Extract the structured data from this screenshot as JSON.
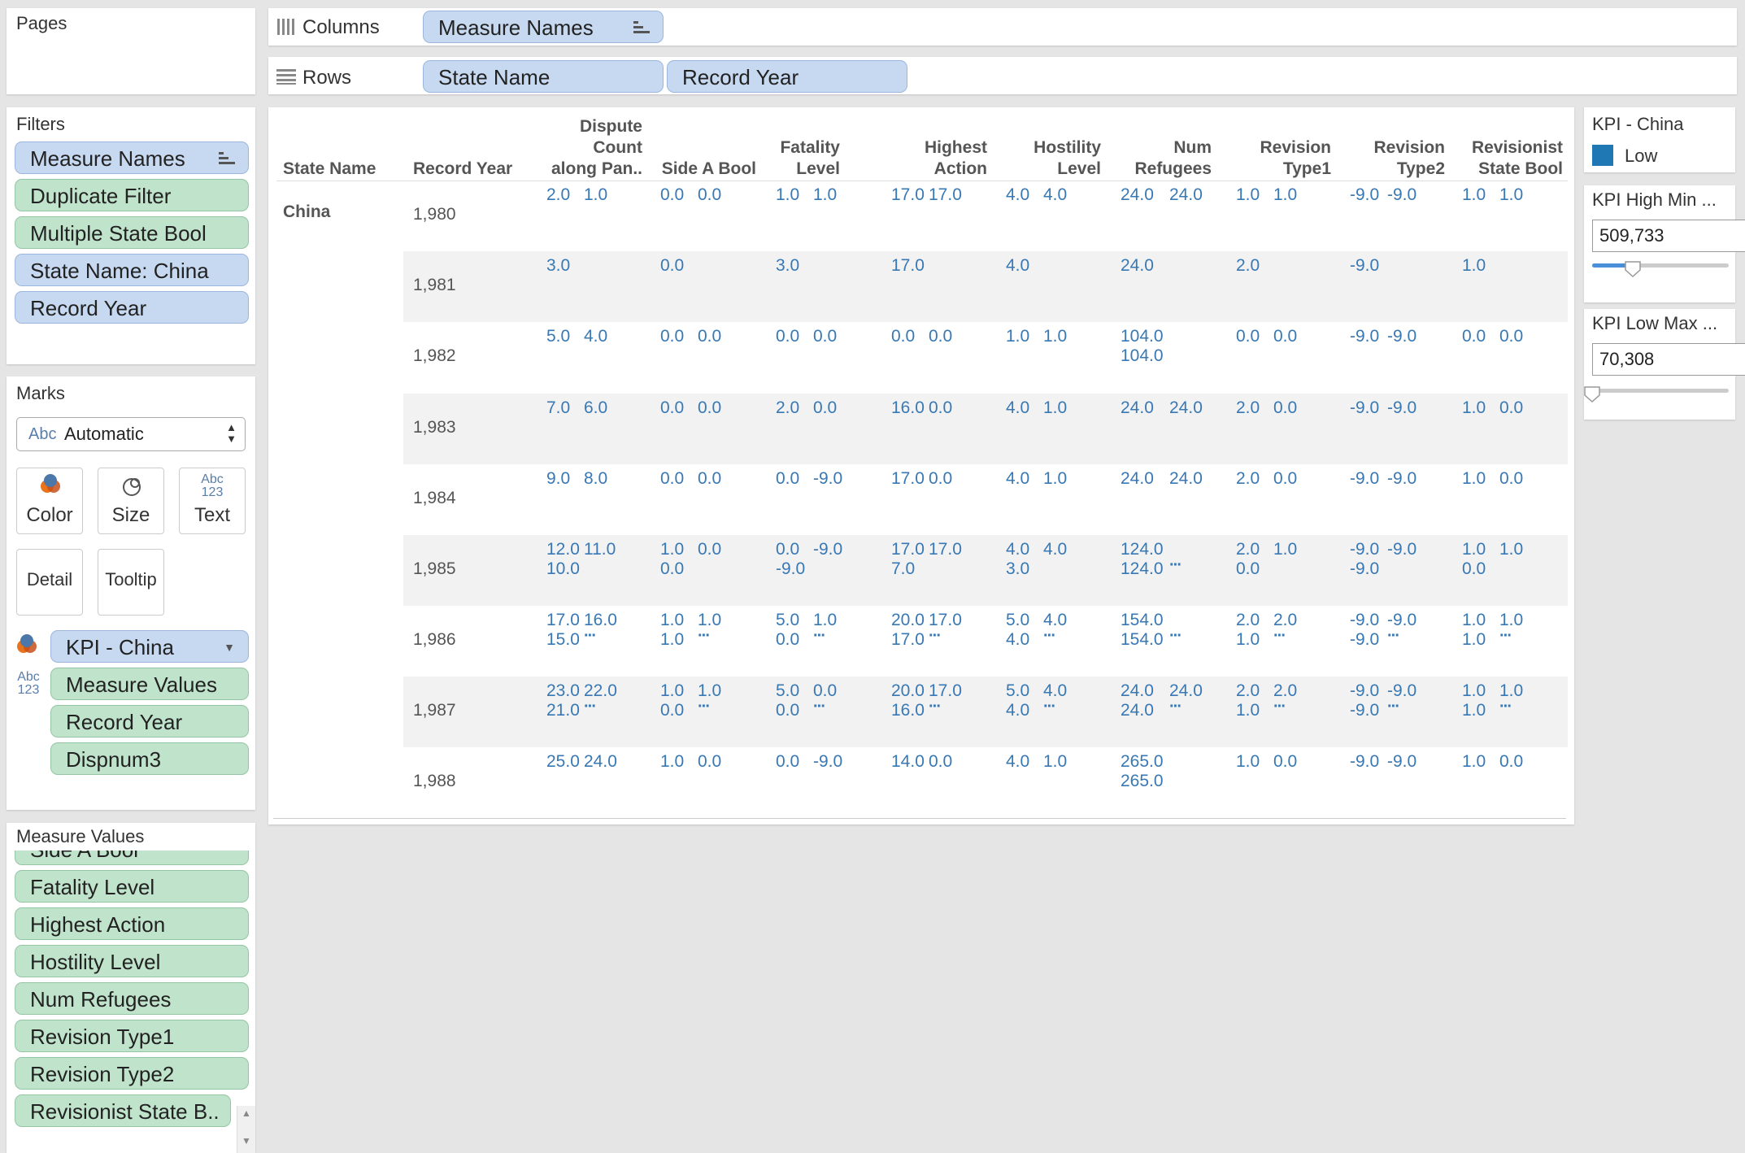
{
  "pages": {
    "title": "Pages"
  },
  "columns_shelf": {
    "label": "Columns",
    "pills": [
      "Measure Names"
    ]
  },
  "rows_shelf": {
    "label": "Rows",
    "pills": [
      "State Name",
      "Record Year"
    ]
  },
  "filters": {
    "title": "Filters",
    "items": [
      {
        "label": "Measure Names",
        "color": "blue"
      },
      {
        "label": "Duplicate Filter",
        "color": "green"
      },
      {
        "label": "Multiple State Bool",
        "color": "green"
      },
      {
        "label": "State Name: China",
        "color": "blue"
      },
      {
        "label": "Record Year",
        "color": "blue"
      }
    ]
  },
  "marks": {
    "title": "Marks",
    "mark_type": {
      "icon_text": "Abc",
      "value": "Automatic"
    },
    "buttons": [
      {
        "label": "Color",
        "icon": "color-icon"
      },
      {
        "label": "Size",
        "icon": "size-icon"
      },
      {
        "label": "Text",
        "icon": "text-icon",
        "icon_text_1": "Abc",
        "icon_text_2": "123"
      },
      {
        "label": "Detail"
      },
      {
        "label": "Tooltip"
      }
    ],
    "fields": [
      {
        "label": "KPI - China",
        "icon": "color-icon",
        "color": "blue"
      },
      {
        "label": "Measure Values",
        "icon": "text-icon",
        "icon_text_1": "Abc",
        "icon_text_2": "123",
        "color": "green"
      },
      {
        "label": "Record Year",
        "color": "green"
      },
      {
        "label": "Dispnum3",
        "color": "green"
      }
    ]
  },
  "measure_values": {
    "title": "Measure Values",
    "items": [
      "Side A Bool",
      "Fatality Level",
      "Highest Action",
      "Hostility Level",
      "Num Refugees",
      "Revision Type1",
      "Revision Type2",
      "Revisionist State B.."
    ]
  },
  "table": {
    "row_headers": [
      "State Name",
      "Record Year"
    ],
    "col_headers": [
      [
        "Dispute",
        "Count",
        "along Pan.."
      ],
      [
        "Side A Bool"
      ],
      [
        "Fatality",
        "Level"
      ],
      [
        "Highest",
        "Action"
      ],
      [
        "Hostility",
        "Level"
      ],
      [
        "Num",
        "Refugees"
      ],
      [
        "Revision",
        "Type1"
      ],
      [
        "Revision",
        "Type2"
      ],
      [
        "Revisionist",
        "State Bool"
      ]
    ],
    "state": "China",
    "rows": [
      {
        "year": "1,980",
        "cells": [
          [
            "2.0",
            "1.0"
          ],
          [
            "0.0",
            "0.0"
          ],
          [
            "1.0",
            "1.0"
          ],
          [
            "17.0",
            "17.0"
          ],
          [
            "4.0",
            "4.0"
          ],
          [
            "24.0",
            "24.0"
          ],
          [
            "1.0",
            "1.0"
          ],
          [
            "-9.0",
            "-9.0"
          ],
          [
            "1.0",
            "1.0"
          ]
        ]
      },
      {
        "year": "1,981",
        "cells": [
          [
            "3.0"
          ],
          [
            "0.0"
          ],
          [
            "3.0"
          ],
          [
            "17.0"
          ],
          [
            "4.0"
          ],
          [
            "24.0"
          ],
          [
            "2.0"
          ],
          [
            "-9.0"
          ],
          [
            "1.0"
          ]
        ]
      },
      {
        "year": "1,982",
        "cells": [
          [
            "5.0",
            "4.0"
          ],
          [
            "0.0",
            "0.0"
          ],
          [
            "0.0",
            "0.0"
          ],
          [
            "0.0",
            "0.0"
          ],
          [
            "1.0",
            "1.0"
          ],
          [
            "104.0",
            "",
            "104.0"
          ],
          [
            "0.0",
            "0.0"
          ],
          [
            "-9.0",
            "-9.0"
          ],
          [
            "0.0",
            "0.0"
          ]
        ]
      },
      {
        "year": "1,983",
        "cells": [
          [
            "7.0",
            "6.0"
          ],
          [
            "0.0",
            "0.0"
          ],
          [
            "2.0",
            "0.0"
          ],
          [
            "16.0",
            "0.0"
          ],
          [
            "4.0",
            "1.0"
          ],
          [
            "24.0",
            "24.0"
          ],
          [
            "2.0",
            "0.0"
          ],
          [
            "-9.0",
            "-9.0"
          ],
          [
            "1.0",
            "0.0"
          ]
        ]
      },
      {
        "year": "1,984",
        "cells": [
          [
            "9.0",
            "8.0"
          ],
          [
            "0.0",
            "0.0"
          ],
          [
            "0.0",
            "-9.0"
          ],
          [
            "17.0",
            "0.0"
          ],
          [
            "4.0",
            "1.0"
          ],
          [
            "24.0",
            "24.0"
          ],
          [
            "2.0",
            "0.0"
          ],
          [
            "-9.0",
            "-9.0"
          ],
          [
            "1.0",
            "0.0"
          ]
        ]
      },
      {
        "year": "1,985",
        "cells": [
          [
            "12.0",
            "11.0",
            "10.0"
          ],
          [
            "1.0",
            "0.0",
            "0.0"
          ],
          [
            "0.0",
            "-9.0",
            "-9.0"
          ],
          [
            "17.0",
            "17.0",
            "7.0"
          ],
          [
            "4.0",
            "4.0",
            "3.0"
          ],
          [
            "124.0",
            "",
            "124.0",
            "···"
          ],
          [
            "2.0",
            "1.0",
            "0.0"
          ],
          [
            "-9.0",
            "-9.0",
            "-9.0"
          ],
          [
            "1.0",
            "1.0",
            "0.0"
          ]
        ]
      },
      {
        "year": "1,986",
        "cells": [
          [
            "17.0",
            "16.0",
            "15.0",
            "···"
          ],
          [
            "1.0",
            "1.0",
            "1.0",
            "···"
          ],
          [
            "5.0",
            "1.0",
            "0.0",
            "···"
          ],
          [
            "20.0",
            "17.0",
            "17.0",
            "···"
          ],
          [
            "5.0",
            "4.0",
            "4.0",
            "···"
          ],
          [
            "154.0",
            "",
            "154.0",
            "···"
          ],
          [
            "2.0",
            "2.0",
            "1.0",
            "···"
          ],
          [
            "-9.0",
            "-9.0",
            "-9.0",
            "···"
          ],
          [
            "1.0",
            "1.0",
            "1.0",
            "···"
          ]
        ]
      },
      {
        "year": "1,987",
        "cells": [
          [
            "23.0",
            "22.0",
            "21.0",
            "···"
          ],
          [
            "1.0",
            "1.0",
            "0.0",
            "···"
          ],
          [
            "5.0",
            "0.0",
            "0.0",
            "···"
          ],
          [
            "20.0",
            "17.0",
            "16.0",
            "···"
          ],
          [
            "5.0",
            "4.0",
            "4.0",
            "···"
          ],
          [
            "24.0",
            "24.0",
            "24.0",
            "···"
          ],
          [
            "2.0",
            "2.0",
            "1.0",
            "···"
          ],
          [
            "-9.0",
            "-9.0",
            "-9.0",
            "···"
          ],
          [
            "1.0",
            "1.0",
            "1.0",
            "···"
          ]
        ]
      },
      {
        "year": "1,988",
        "cells": [
          [
            "25.0",
            "24.0"
          ],
          [
            "1.0",
            "0.0"
          ],
          [
            "0.0",
            "-9.0"
          ],
          [
            "14.0",
            "0.0"
          ],
          [
            "4.0",
            "1.0"
          ],
          [
            "265.0",
            "",
            "265.0"
          ],
          [
            "1.0",
            "0.0"
          ],
          [
            "-9.0",
            "-9.0"
          ],
          [
            "1.0",
            "0.0"
          ]
        ]
      }
    ]
  },
  "legend": {
    "title": "KPI - China",
    "items": [
      {
        "label": "Low",
        "color": "#1f77b4"
      }
    ]
  },
  "filter_high": {
    "title": "KPI High Min ...",
    "value": "509,733",
    "level": 0.3
  },
  "filter_low": {
    "title": "KPI Low Max ...",
    "value": "70,308",
    "level": 0.0
  },
  "colors": {
    "accent": "#3878b4",
    "pill_blue": "#c7d9f1",
    "pill_green": "#c0e3cb"
  }
}
